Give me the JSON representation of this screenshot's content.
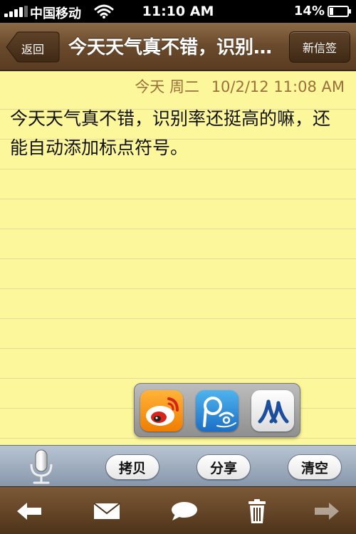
{
  "status": {
    "carrier": "中国移动",
    "time": "11:10 AM",
    "battery": "14%"
  },
  "nav": {
    "back_label": "返回",
    "title": "今天天气真不错，识别率还挺高的嘛，还能自动添加标点符号。",
    "new_label": "新信签"
  },
  "note": {
    "day_label": "今天",
    "weekday": "周二",
    "timestamp": "10/2/12 11:08 AM",
    "text": "今天天气真不错，识别率还挺高的嘛，还能自动添加标点符号。"
  },
  "share_apps": [
    "weibo-icon",
    "tencent-weibo-icon",
    "renren-icon"
  ],
  "toolbar": {
    "copy_label": "拷贝",
    "share_label": "分享",
    "clear_label": "清空"
  },
  "colors": {
    "paper": "#fcf79a",
    "date_text": "#9c6f3c",
    "nav_brown": "#6a4a2c"
  }
}
